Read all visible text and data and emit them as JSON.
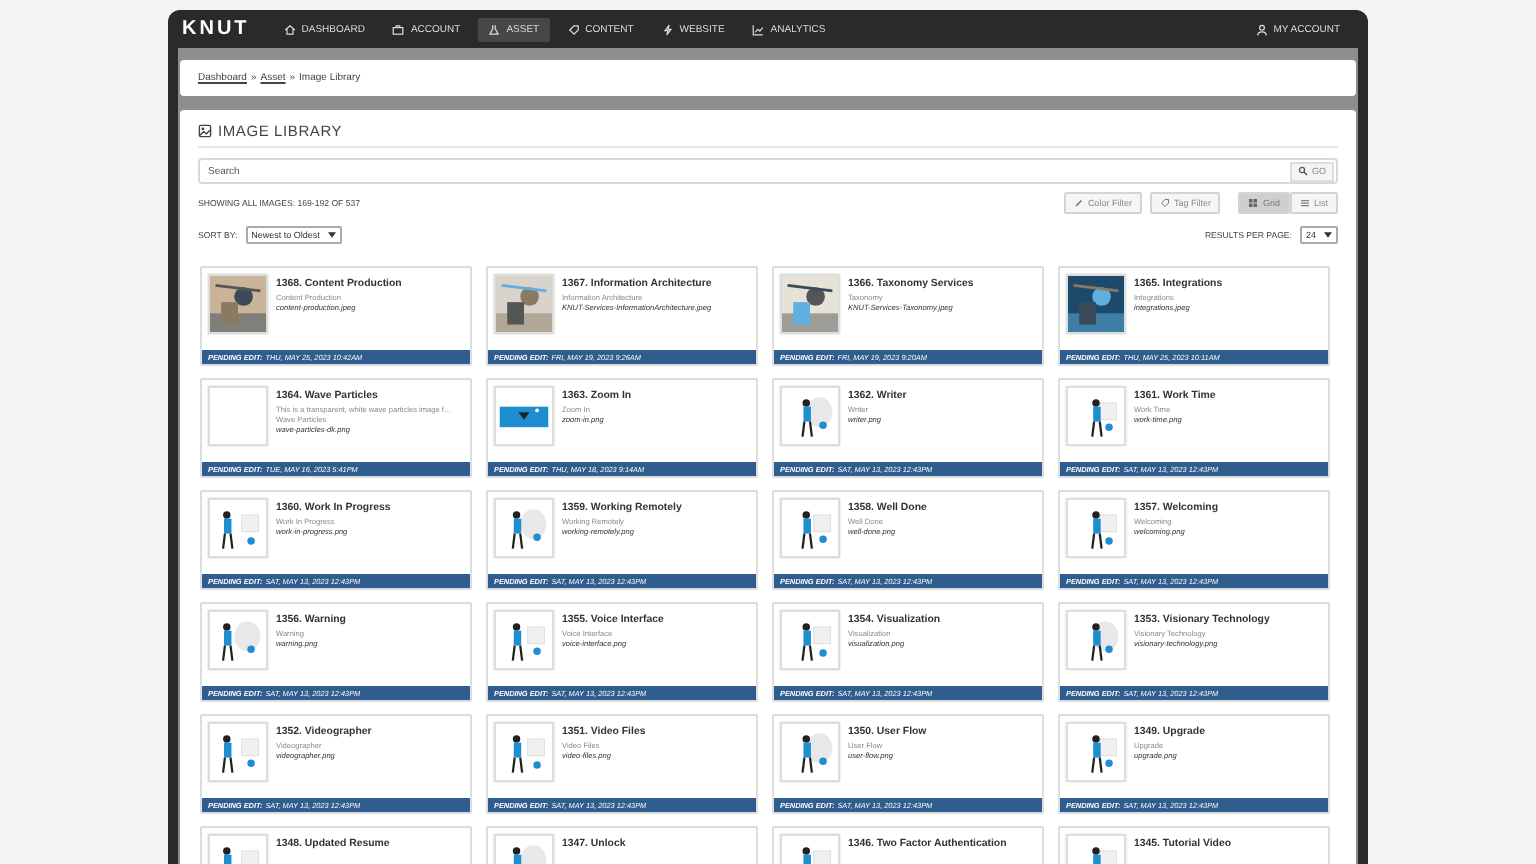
{
  "nav": {
    "logo": "KNUT",
    "items": [
      {
        "label": "DASHBOARD",
        "selected": false
      },
      {
        "label": "ACCOUNT",
        "selected": false
      },
      {
        "label": "ASSET",
        "selected": true
      },
      {
        "label": "CONTENT",
        "selected": false
      },
      {
        "label": "WEBSITE",
        "selected": false
      },
      {
        "label": "ANALYTICS",
        "selected": false
      }
    ],
    "account": "MY ACCOUNT"
  },
  "breadcrumb": {
    "links": [
      "Dashboard",
      "Asset"
    ],
    "separators": [
      "»",
      "»"
    ],
    "current": "Image Library"
  },
  "heading": "IMAGE LIBRARY",
  "search": {
    "placeholder": "Search",
    "button": "GO"
  },
  "showing": "SHOWING ALL IMAGES: 169-192 OF 537",
  "filters": [
    "Color Filter",
    "Tag Filter"
  ],
  "views": [
    {
      "label": "Grid",
      "selected": true
    },
    {
      "label": "List",
      "selected": false
    }
  ],
  "sort": {
    "label": "SORT BY:",
    "value": "Newest to Oldest"
  },
  "per_page": {
    "label": "RESULTS PER PAGE:",
    "value": "24"
  },
  "cards": [
    {
      "title": "1368. Content Production",
      "subtitle": "Content Production",
      "file": "content-production.jpeg",
      "pending": "PENDING EDIT:",
      "date": "THU, MAY 25, 2023 10:42AM"
    },
    {
      "title": "1367. Information Architecture",
      "subtitle": "Information Architecture",
      "file": "KNUT-Services-InformationArchitecture.jpeg",
      "pending": "PENDING EDIT:",
      "date": "FRI, MAY 19, 2023 9:26AM"
    },
    {
      "title": "1366. Taxonomy Services",
      "subtitle": "Taxonomy",
      "file": "KNUT-Services-Taxonomy.jpeg",
      "pending": "PENDING EDIT:",
      "date": "FRI, MAY 19, 2023 9:20AM"
    },
    {
      "title": "1365. Integrations",
      "subtitle": "Integrations",
      "file": "integrations.jpeg",
      "pending": "PENDING EDIT:",
      "date": "THU, MAY 25, 2023 10:11AM"
    },
    {
      "kind": "blank",
      "title": "1364. Wave Particles",
      "description": "This is a transparent, white wave particles image f...",
      "subtitle": "Wave Particles",
      "file": "wave-particles-dk.png",
      "pending": "PENDING EDIT:",
      "date": "TUE, MAY 16, 2023 5:41PM"
    },
    {
      "kind": "banner",
      "title": "1363. Zoom In",
      "subtitle": "Zoom In",
      "file": "zoom-in.png",
      "pending": "PENDING EDIT:",
      "date": "THU, MAY 18, 2023 9:14AM"
    },
    {
      "kind": "illustration",
      "title": "1362. Writer",
      "subtitle": "Writer",
      "file": "writer.png",
      "pending": "PENDING EDIT:",
      "date": "SAT, MAY 13, 2023 12:43PM"
    },
    {
      "kind": "illustration",
      "title": "1361. Work Time",
      "subtitle": "Work Time",
      "file": "work-time.png",
      "pending": "PENDING EDIT:",
      "date": "SAT, MAY 13, 2023 12:43PM"
    },
    {
      "kind": "illustration",
      "title": "1360. Work In Progress",
      "subtitle": "Work In Progress",
      "file": "work-in-progress.png",
      "pending": "PENDING EDIT:",
      "date": "SAT, MAY 13, 2023 12:43PM"
    },
    {
      "kind": "illustration",
      "title": "1359. Working Remotely",
      "subtitle": "Working Remotely",
      "file": "working-remotely.png",
      "pending": "PENDING EDIT:",
      "date": "SAT, MAY 13, 2023 12:43PM"
    },
    {
      "kind": "illustration",
      "title": "1358. Well Done",
      "subtitle": "Well Done",
      "file": "well-done.png",
      "pending": "PENDING EDIT:",
      "date": "SAT, MAY 13, 2023 12:43PM"
    },
    {
      "kind": "illustration",
      "title": "1357. Welcoming",
      "subtitle": "Welcoming",
      "file": "welcoming.png",
      "pending": "PENDING EDIT:",
      "date": "SAT, MAY 13, 2023 12:43PM"
    },
    {
      "kind": "illustration",
      "title": "1356. Warning",
      "subtitle": "Warning",
      "file": "warning.png",
      "pending": "PENDING EDIT:",
      "date": "SAT, MAY 13, 2023 12:43PM"
    },
    {
      "kind": "illustration",
      "title": "1355. Voice Interface",
      "subtitle": "Voice Interface",
      "file": "voice-interface.png",
      "pending": "PENDING EDIT:",
      "date": "SAT, MAY 13, 2023 12:43PM"
    },
    {
      "kind": "illustration",
      "title": "1354. Visualization",
      "subtitle": "Visualization",
      "file": "visualization.png",
      "pending": "PENDING EDIT:",
      "date": "SAT, MAY 13, 2023 12:43PM"
    },
    {
      "kind": "illustration",
      "title": "1353. Visionary Technology",
      "subtitle": "Visionary Technology",
      "file": "visionary-technology.png",
      "pending": "PENDING EDIT:",
      "date": "SAT, MAY 13, 2023 12:43PM"
    },
    {
      "kind": "illustration",
      "title": "1352. Videographer",
      "subtitle": "Videographer",
      "file": "videographer.png",
      "pending": "PENDING EDIT:",
      "date": "SAT, MAY 13, 2023 12:43PM"
    },
    {
      "kind": "illustration",
      "title": "1351. Video Files",
      "subtitle": "Video Files",
      "file": "video-files.png",
      "pending": "PENDING EDIT:",
      "date": "SAT, MAY 13, 2023 12:43PM"
    },
    {
      "kind": "illustration",
      "title": "1350. User Flow",
      "subtitle": "User Flow",
      "file": "user-flow.png",
      "pending": "PENDING EDIT:",
      "date": "SAT, MAY 13, 2023 12:43PM"
    },
    {
      "kind": "illustration",
      "title": "1349. Upgrade",
      "subtitle": "Upgrade",
      "file": "upgrade.png",
      "pending": "PENDING EDIT:",
      "date": "SAT, MAY 13, 2023 12:43PM"
    },
    {
      "kind": "illustration",
      "title": "1348. Updated Resume"
    },
    {
      "kind": "illustration",
      "title": "1347. Unlock"
    },
    {
      "kind": "illustration",
      "title": "1346. Two Factor Authentication"
    },
    {
      "kind": "illustration",
      "title": "1345. Tutorial Video"
    }
  ]
}
